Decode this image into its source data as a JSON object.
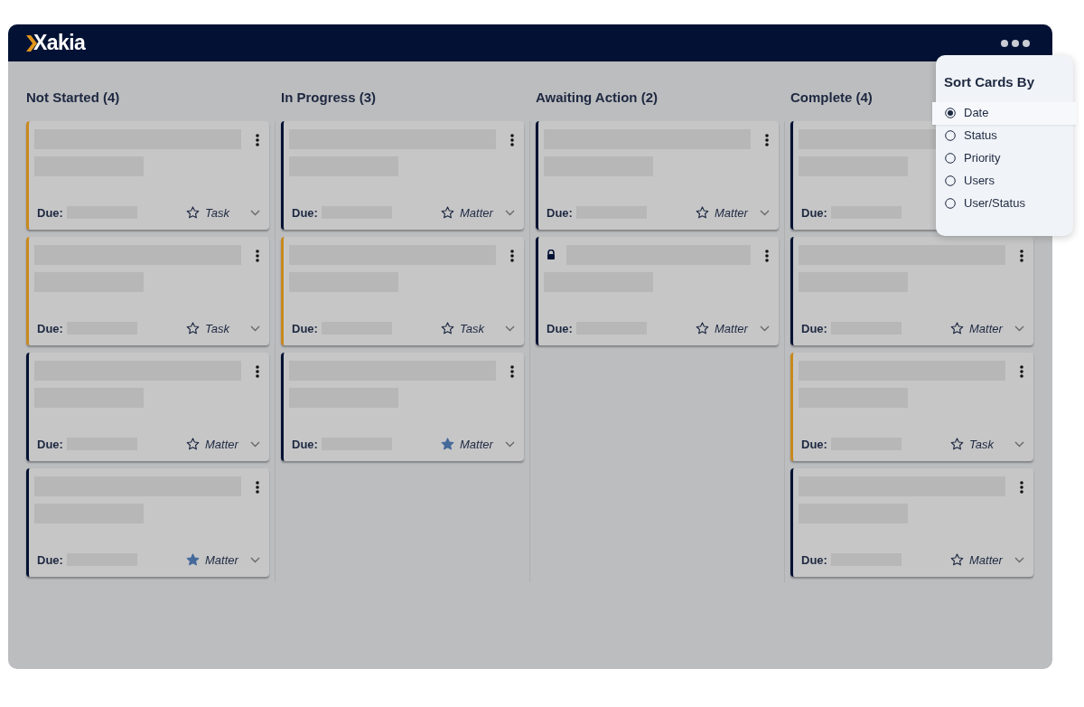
{
  "app": {
    "logo": "Xakia"
  },
  "columns": [
    {
      "title": "Not Started (4)",
      "cards": [
        {
          "kind": "task",
          "label": "Task",
          "due_label": "Due:",
          "starred": false,
          "locked": false
        },
        {
          "kind": "task",
          "label": "Task",
          "due_label": "Due:",
          "starred": false,
          "locked": false
        },
        {
          "kind": "matter",
          "label": "Matter",
          "due_label": "Due:",
          "starred": false,
          "locked": false
        },
        {
          "kind": "matter",
          "label": "Matter",
          "due_label": "Due:",
          "starred": true,
          "locked": false
        }
      ]
    },
    {
      "title": "In Progress (3)",
      "cards": [
        {
          "kind": "matter",
          "label": "Matter",
          "due_label": "Due:",
          "starred": false,
          "locked": false
        },
        {
          "kind": "task",
          "label": "Task",
          "due_label": "Due:",
          "starred": false,
          "locked": false
        },
        {
          "kind": "matter",
          "label": "Matter",
          "due_label": "Due:",
          "starred": true,
          "locked": false
        }
      ]
    },
    {
      "title": "Awaiting Action (2)",
      "cards": [
        {
          "kind": "matter",
          "label": "Matter",
          "due_label": "Due:",
          "starred": false,
          "locked": false
        },
        {
          "kind": "matter",
          "label": "Matter",
          "due_label": "Due:",
          "starred": false,
          "locked": true
        }
      ]
    },
    {
      "title": "Complete (4)",
      "cards": [
        {
          "kind": "matter",
          "due_label": "Due:",
          "locked": false
        },
        {
          "kind": "matter",
          "label": "Matter",
          "due_label": "Due:",
          "starred": false,
          "locked": false
        },
        {
          "kind": "task",
          "label": "Task",
          "due_label": "Due:",
          "starred": false,
          "locked": false
        },
        {
          "kind": "matter",
          "label": "Matter",
          "due_label": "Due:",
          "starred": false,
          "locked": false
        }
      ]
    }
  ],
  "sort_menu": {
    "title": "Sort Cards By",
    "options": [
      {
        "label": "Date",
        "selected": true
      },
      {
        "label": "Status",
        "selected": false
      },
      {
        "label": "Priority",
        "selected": false
      },
      {
        "label": "Users",
        "selected": false
      },
      {
        "label": "User/Status",
        "selected": false
      }
    ]
  }
}
